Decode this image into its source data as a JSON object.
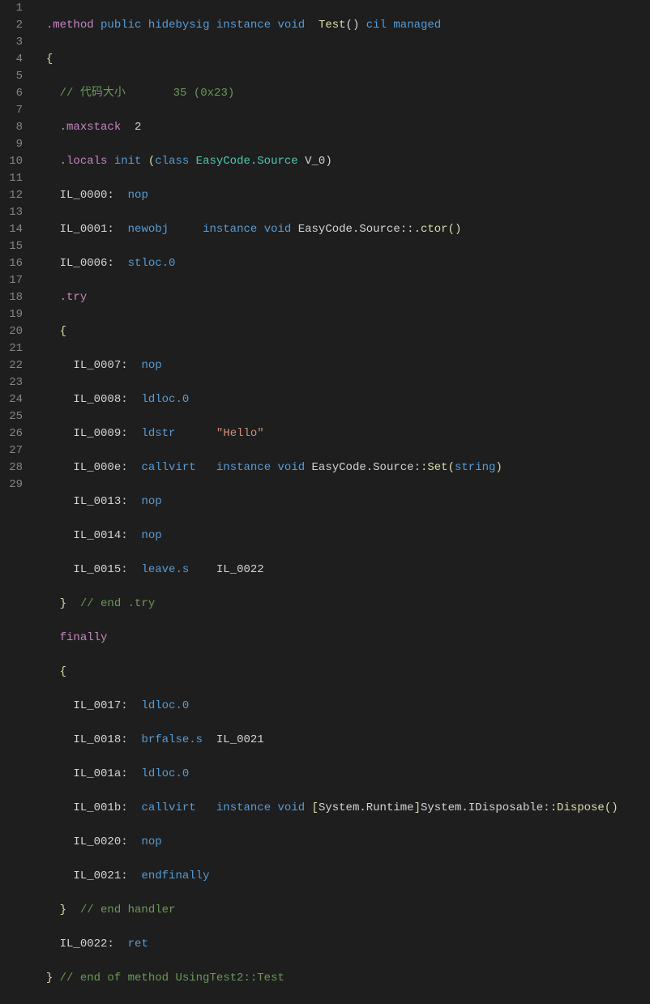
{
  "lineNumbers": [
    "1",
    "2",
    "3",
    "4",
    "5",
    "6",
    "7",
    "8",
    "9",
    "10",
    "11",
    "12",
    "13",
    "14",
    "15",
    "16",
    "17",
    "18",
    "19",
    "20",
    "21",
    "22",
    "23",
    "24",
    "25",
    "26",
    "27",
    "28",
    "29"
  ],
  "lines": {
    "l1": {
      "dotMethod": ".method",
      "public": "public",
      "hidebysig": "hidebysig",
      "instance": "instance",
      "void": "void",
      "test": "Test",
      "parens": "()",
      "cil": "cil",
      "managed": "managed"
    },
    "l2": {
      "brace": "{"
    },
    "l3": {
      "commentPrefix": "// ",
      "commentText": "代码大小",
      "commentSize": "       35 (0x23)"
    },
    "l4": {
      "maxstack": ".maxstack",
      "num": "2"
    },
    "l5": {
      "locals": ".locals",
      "init": "init",
      "open": "(",
      "class": "class",
      "type": "EasyCode.Source",
      "var": "V_0",
      "close": ")"
    },
    "l6": {
      "label": "IL_0000:",
      "op": "nop"
    },
    "l7": {
      "label": "IL_0001:",
      "op": "newobj",
      "instance": "instance",
      "void": "void",
      "type": "EasyCode.Source",
      "dcolon": "::",
      "ctorDot": ".",
      "ctor": "ctor",
      "parens": "()"
    },
    "l8": {
      "label": "IL_0006:",
      "op": "stloc.0"
    },
    "l9": {
      "try": ".try"
    },
    "l10": {
      "brace": "{"
    },
    "l11": {
      "label": "IL_0007:",
      "op": "nop"
    },
    "l12": {
      "label": "IL_0008:",
      "op": "ldloc.0"
    },
    "l13": {
      "label": "IL_0009:",
      "op": "ldstr",
      "str": "\"Hello\""
    },
    "l14": {
      "label": "IL_000e:",
      "op": "callvirt",
      "instance": "instance",
      "void": "void",
      "type": "EasyCode.Source",
      "dcolon": "::",
      "method": "Set",
      "open": "(",
      "arg": "string",
      "close": ")"
    },
    "l15": {
      "label": "IL_0013:",
      "op": "nop"
    },
    "l16": {
      "label": "IL_0014:",
      "op": "nop"
    },
    "l17": {
      "label": "IL_0015:",
      "op": "leave.s",
      "target": "IL_0022"
    },
    "l18": {
      "brace": "}",
      "comment": "  // end .try"
    },
    "l19": {
      "finally": "finally"
    },
    "l20": {
      "brace": "{"
    },
    "l21": {
      "label": "IL_0017:",
      "op": "ldloc.0"
    },
    "l22": {
      "label": "IL_0018:",
      "op": "brfalse.s",
      "target": "IL_0021"
    },
    "l23": {
      "label": "IL_001a:",
      "op": "ldloc.0"
    },
    "l24": {
      "label": "IL_001b:",
      "op": "callvirt",
      "instance": "instance",
      "void": "void",
      "open": "[",
      "asm": "System.Runtime",
      "close": "]",
      "type": "System.IDisposable",
      "dcolon": "::",
      "method": "Dispose",
      "parens": "()"
    },
    "l25": {
      "label": "IL_0020:",
      "op": "nop"
    },
    "l26": {
      "label": "IL_0021:",
      "op": "endfinally"
    },
    "l27": {
      "brace": "}",
      "comment": "  // end handler"
    },
    "l28": {
      "label": "IL_0022:",
      "op": "ret"
    },
    "l29": {
      "brace": "}",
      "comment": " // end of method UsingTest2::Test"
    }
  }
}
